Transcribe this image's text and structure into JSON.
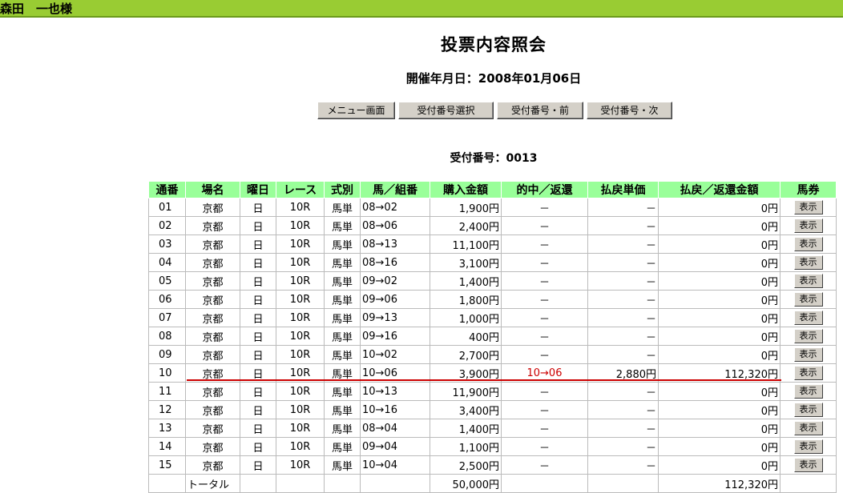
{
  "user": {
    "name": "森田　一也様"
  },
  "page": {
    "title": "投票内容照会",
    "date_label": "開催年月日：2008年01月06日"
  },
  "buttons": [
    "メニュー画面",
    "受付番号選択",
    "受付番号・前",
    "受付番号・次"
  ],
  "receipt": {
    "label": "受付番号：0013"
  },
  "table": {
    "headers": [
      "通番",
      "場名",
      "曜日",
      "レース",
      "式別",
      "馬／組番",
      "購入金額",
      "的中／返還",
      "払戻単価",
      "払戻／返還金額",
      "馬券"
    ],
    "rows": [
      [
        "01",
        "京都",
        "日",
        "10R",
        "馬単",
        "08→02",
        "1,900円",
        "－",
        "－",
        "0円",
        "表示"
      ],
      [
        "02",
        "京都",
        "日",
        "10R",
        "馬単",
        "08→06",
        "2,400円",
        "－",
        "－",
        "0円",
        "表示"
      ],
      [
        "03",
        "京都",
        "日",
        "10R",
        "馬単",
        "08→13",
        "11,100円",
        "－",
        "－",
        "0円",
        "表示"
      ],
      [
        "04",
        "京都",
        "日",
        "10R",
        "馬単",
        "08→16",
        "3,100円",
        "－",
        "－",
        "0円",
        "表示"
      ],
      [
        "05",
        "京都",
        "日",
        "10R",
        "馬単",
        "09→02",
        "1,400円",
        "－",
        "－",
        "0円",
        "表示"
      ],
      [
        "06",
        "京都",
        "日",
        "10R",
        "馬単",
        "09→06",
        "1,800円",
        "－",
        "－",
        "0円",
        "表示"
      ],
      [
        "07",
        "京都",
        "日",
        "10R",
        "馬単",
        "09→13",
        "1,000円",
        "－",
        "－",
        "0円",
        "表示"
      ],
      [
        "08",
        "京都",
        "日",
        "10R",
        "馬単",
        "09→16",
        "400円",
        "－",
        "－",
        "0円",
        "表示"
      ],
      [
        "09",
        "京都",
        "日",
        "10R",
        "馬単",
        "10→02",
        "2,700円",
        "－",
        "－",
        "0円",
        "表示"
      ],
      [
        "10",
        "京都",
        "日",
        "10R",
        "馬単",
        "10→06",
        "3,900円",
        "10→06",
        "2,880円",
        "112,320円",
        "表示"
      ],
      [
        "11",
        "京都",
        "日",
        "10R",
        "馬単",
        "10→13",
        "11,900円",
        "－",
        "－",
        "0円",
        "表示"
      ],
      [
        "12",
        "京都",
        "日",
        "10R",
        "馬単",
        "10→16",
        "3,400円",
        "－",
        "－",
        "0円",
        "表示"
      ],
      [
        "13",
        "京都",
        "日",
        "10R",
        "馬単",
        "08→04",
        "1,400円",
        "－",
        "－",
        "0円",
        "表示"
      ],
      [
        "14",
        "京都",
        "日",
        "10R",
        "馬単",
        "09→04",
        "1,100円",
        "－",
        "－",
        "0円",
        "表示"
      ],
      [
        "15",
        "京都",
        "日",
        "10R",
        "馬単",
        "10→04",
        "2,500円",
        "－",
        "－",
        "0円",
        "表示"
      ]
    ],
    "total": {
      "label": "トータル",
      "purchase": "50,000円",
      "payout": "112,320円"
    }
  },
  "colors": {
    "header_bg": "#99ff99",
    "user_bar": "#99cc33",
    "hit_text": "#cc0000"
  }
}
